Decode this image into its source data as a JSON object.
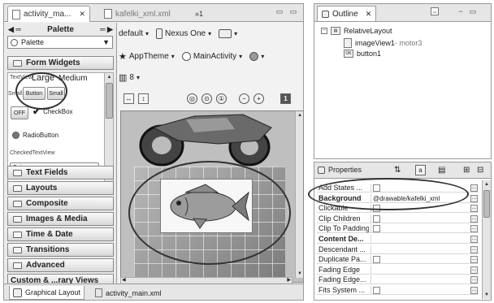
{
  "editor": {
    "tabs": [
      {
        "label": "activity_ma...",
        "close": "✕"
      },
      {
        "label": "kafelki_xml.xml"
      }
    ],
    "overflow": "»1",
    "palette": {
      "title": "Palette",
      "combo": "Palette",
      "widgets": {
        "textview_label": "TextView",
        "sizes": [
          "Large",
          "Medium"
        ],
        "buttons": [
          "Small",
          "Button",
          "Small"
        ],
        "off_toggle": "OFF",
        "checkbox": "CheckBox",
        "radiobutton": "RadioButton",
        "checkedtextview": "CheckedTextView",
        "spinner": "Spinner"
      },
      "categories": [
        "Form Widgets",
        "Text Fields",
        "Layouts",
        "Composite",
        "Images & Media",
        "Time & Date",
        "Transitions",
        "Advanced",
        "Custom & ...rary Views"
      ]
    },
    "toolbar": {
      "config": "default",
      "device": "Nexus One",
      "theme": "AppTheme",
      "activity": "MainActivity",
      "api": "8"
    },
    "zoom_badge": "1",
    "bottom_tabs": [
      "Graphical Layout",
      "activity_main.xml"
    ]
  },
  "outline": {
    "title": "Outline",
    "close": "✕",
    "tree": [
      {
        "label": "RelativeLayout"
      },
      {
        "label": "imageView1",
        "detail": " - motor3"
      },
      {
        "label": "button1",
        "icon_text": "OK"
      }
    ]
  },
  "properties": {
    "title": "Properties",
    "rows": [
      {
        "name": "Add States ...",
        "value": "",
        "check": true,
        "ellipsis": true
      },
      {
        "name": "Background",
        "value": "@drawable/kafelki_xml",
        "bold": true,
        "ellipsis": true
      },
      {
        "name": "Clickable",
        "value": "",
        "check": true,
        "ellipsis": true
      },
      {
        "name": "Clip Children",
        "value": "",
        "check": true,
        "ellipsis": true
      },
      {
        "name": "Clip To Padding",
        "value": "",
        "check": true,
        "ellipsis": true
      },
      {
        "name": "Content De...",
        "value": "",
        "bold": true,
        "ellipsis": true
      },
      {
        "name": "Descendant ...",
        "value": "",
        "ellipsis": true
      },
      {
        "name": "Duplicate Pa...",
        "value": "",
        "check": true,
        "ellipsis": true
      },
      {
        "name": "Fading Edge",
        "value": "",
        "ellipsis": true
      },
      {
        "name": "Fading Edge...",
        "value": "",
        "ellipsis": true
      },
      {
        "name": "Fits System ...",
        "value": "",
        "check": true,
        "ellipsis": true
      }
    ]
  },
  "icons": [
    "layout-file-icon",
    "xml-file-icon",
    "minimize-icon",
    "maximize-icon",
    "outline-icon",
    "properties-icon",
    "folder-icon",
    "zoom-icon",
    "image-view-icon",
    "button-widget-icon",
    "motorcycle-image",
    "fish-image"
  ]
}
